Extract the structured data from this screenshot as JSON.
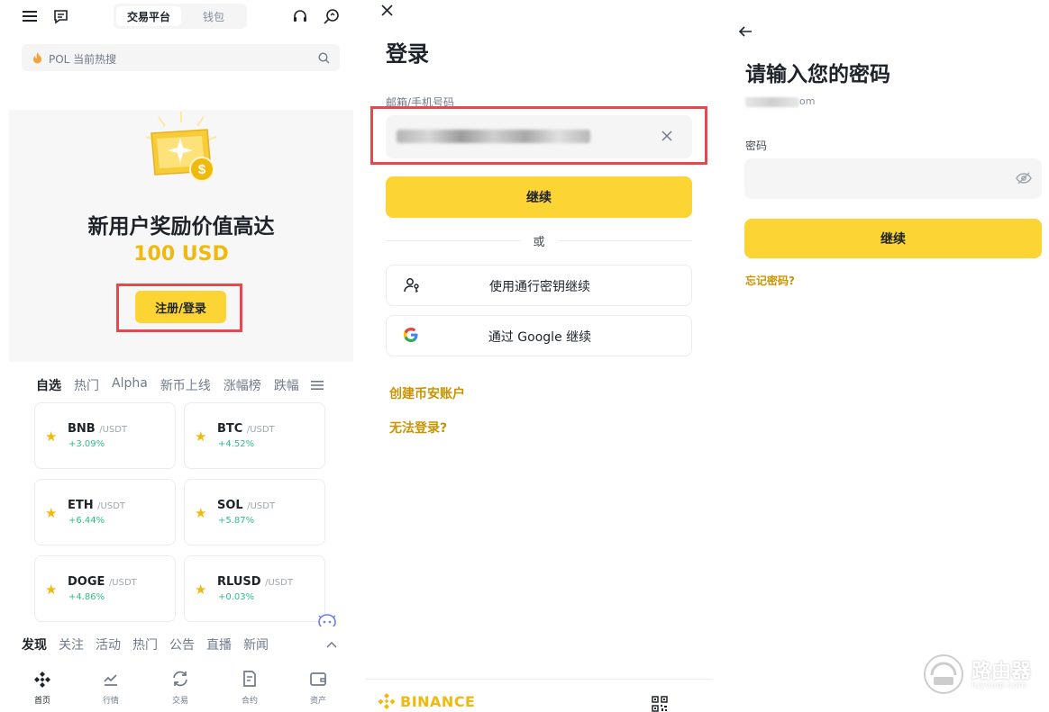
{
  "screen1": {
    "header": {
      "tab_active": "交易平台",
      "tab_inactive": "钱包"
    },
    "search": {
      "placeholder": "POL 当前热搜"
    },
    "promo": {
      "title": "新用户奖励价值高达",
      "amount": "100 USD",
      "cta": "注册/登录"
    },
    "market": {
      "tabs": [
        "自选",
        "热门",
        "Alpha",
        "新币上线",
        "涨幅榜",
        "跌幅"
      ],
      "quote": "/USDT",
      "coins": [
        {
          "symbol": "BNB",
          "change": "+3.09%"
        },
        {
          "symbol": "BTC",
          "change": "+4.52%"
        },
        {
          "symbol": "ETH",
          "change": "+6.44%"
        },
        {
          "symbol": "SOL",
          "change": "+5.87%"
        },
        {
          "symbol": "DOGE",
          "change": "+4.86%"
        },
        {
          "symbol": "RLUSD",
          "change": "+0.03%"
        }
      ]
    },
    "discover": {
      "tabs": [
        "发现",
        "关注",
        "活动",
        "热门",
        "公告",
        "直播",
        "新闻"
      ]
    },
    "bottom_nav": [
      "首页",
      "行情",
      "交易",
      "合约",
      "资产"
    ],
    "colors": {
      "accent": "#fcd535",
      "gold_text": "#f0b90b",
      "up": "#2ebd85",
      "highlight": "#e5484d"
    }
  },
  "screen2": {
    "title": "登录",
    "email_label": "邮箱/手机号码",
    "continue": "继续",
    "or": "或",
    "passkey_button": "使用通行密钥继续",
    "google_button": "通过 Google 继续",
    "create_account": "创建币安账户",
    "cant_login": "无法登录?",
    "brand": "BINANCE"
  },
  "screen3": {
    "title": "请输入您的密码",
    "email_tail": "om",
    "password_label": "密码",
    "continue": "继续",
    "forgot": "忘记密码?"
  },
  "watermark": {
    "text": "路由器",
    "sub": "luyouqi.com"
  }
}
